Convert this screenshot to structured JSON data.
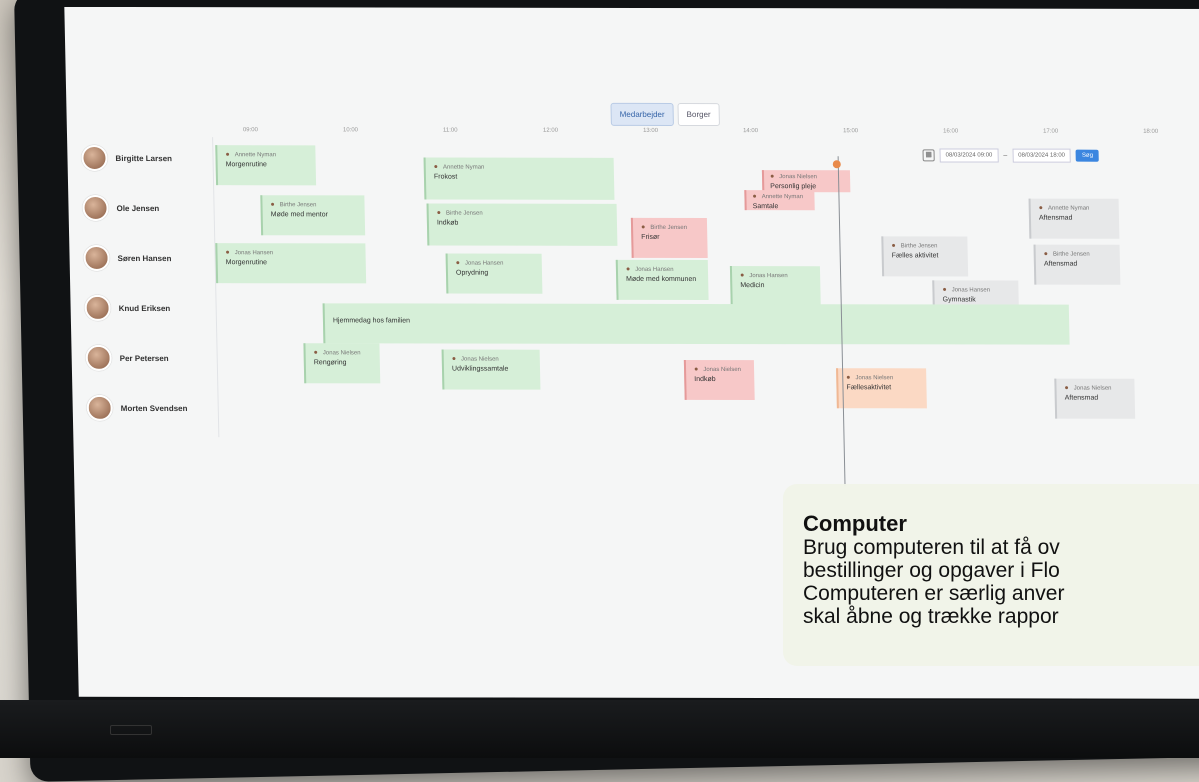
{
  "segments": [
    "Medarbejder",
    "Borger"
  ],
  "people": [
    "Birgitte Larsen",
    "Ole Jensen",
    "Søren Hansen",
    "Knud Eriksen",
    "Per Petersen",
    "Morten Svendsen"
  ],
  "ticks": [
    "09:00",
    "10:00",
    "11:00",
    "12:00",
    "13:00",
    "14:00",
    "15:00",
    "16:00",
    "17:00",
    "18:00"
  ],
  "date_from": "08/03/2024 09:00",
  "date_to": "08/03/2024 18:00",
  "date_sep": "–",
  "go_label": "Søg",
  "events": [
    {
      "who": "Annette Nyman",
      "title": "Morgenrutine",
      "color": "green"
    },
    {
      "who": "Annette Nyman",
      "title": "Frokost",
      "color": "green"
    },
    {
      "who": "Jonas Nielsen",
      "title": "Personlig pleje",
      "color": "red"
    },
    {
      "who": "Annette Nyman",
      "title": "Samtale",
      "color": "red"
    },
    {
      "who": "Annette Nyman",
      "title": "Aftensmad",
      "color": "gray"
    },
    {
      "who": "Birthe Jensen",
      "title": "Møde med mentor",
      "color": "green"
    },
    {
      "who": "Birthe Jensen",
      "title": "Indkøb",
      "color": "green"
    },
    {
      "who": "Birthe Jensen",
      "title": "Frisør",
      "color": "red"
    },
    {
      "who": "Birthe Jensen",
      "title": "Fælles aktivitet",
      "color": "gray"
    },
    {
      "who": "Birthe Jensen",
      "title": "Aftensmad",
      "color": "gray"
    },
    {
      "who": "Jonas Hansen",
      "title": "Morgenrutine",
      "color": "green"
    },
    {
      "who": "Jonas Hansen",
      "title": "Oprydning",
      "color": "green"
    },
    {
      "who": "Jonas Hansen",
      "title": "Møde med kommunen",
      "color": "green"
    },
    {
      "who": "Jonas Hansen",
      "title": "Medicin",
      "color": "green"
    },
    {
      "who": "Jonas Hansen",
      "title": "Gymnastik",
      "color": "gray"
    },
    {
      "who": "",
      "title": "Hjemmedag hos familien",
      "color": "green"
    },
    {
      "who": "Jonas Nielsen",
      "title": "Rengøring",
      "color": "green"
    },
    {
      "who": "Jonas Nielsen",
      "title": "Udviklingssamtale",
      "color": "green"
    },
    {
      "who": "Jonas Nielsen",
      "title": "Indkøb",
      "color": "red"
    },
    {
      "who": "Jonas Nielsen",
      "title": "Fællesaktivitet",
      "color": "orange"
    },
    {
      "who": "Jonas Nielsen",
      "title": "Aftensmad",
      "color": "gray"
    }
  ],
  "caption": {
    "title": "Computer",
    "line1": "Brug computeren til at få ov",
    "line2": "bestillinger og opgaver i Flo",
    "line3": "Computeren er særlig anver",
    "line4": "skal åbne og trække rappor"
  }
}
